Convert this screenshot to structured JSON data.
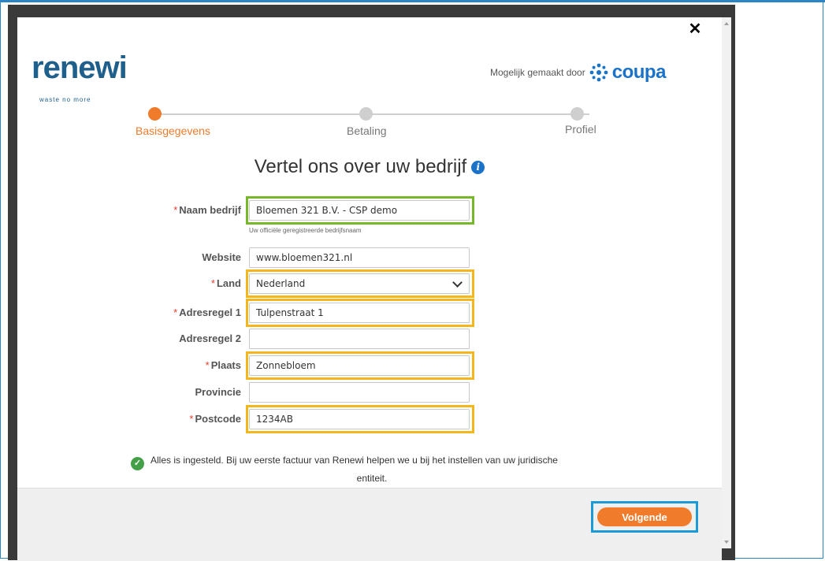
{
  "dialog": {
    "close_glyph": "✕"
  },
  "brand": {
    "logo_text": "renewi",
    "logo_tagline": "waste no more"
  },
  "powered_by": {
    "label": "Mogelijk gemaakt door",
    "brand": "coupa"
  },
  "steps": [
    {
      "label": "Basisgegevens",
      "state": "active"
    },
    {
      "label": "Betaling",
      "state": "inactive"
    },
    {
      "label": "Profiel",
      "state": "inactive"
    }
  ],
  "heading": {
    "title": "Vertel ons over uw bedrijf",
    "info_glyph": "i"
  },
  "form": {
    "company_name": {
      "label": "Naam bedrijf",
      "required": "*",
      "value": "Bloemen 321 B.V. - CSP demo",
      "hint": "Uw officiële geregistreerde bedrijfsnaam"
    },
    "website": {
      "label": "Website",
      "value": "www.bloemen321.nl"
    },
    "country": {
      "label": "Land",
      "required": "*",
      "value": "Nederland"
    },
    "address1": {
      "label": "Adresregel 1",
      "required": "*",
      "value": "Tulpenstraat 1"
    },
    "address2": {
      "label": "Adresregel 2",
      "value": ""
    },
    "city": {
      "label": "Plaats",
      "required": "*",
      "value": "Zonnebloem"
    },
    "province": {
      "label": "Provincie",
      "value": ""
    },
    "postcode": {
      "label": "Postcode",
      "required": "*",
      "value": "1234AB"
    }
  },
  "status": {
    "line1": "Alles is ingesteld. Bij uw eerste factuur van Renewi helpen we u bij het instellen van uw juridische",
    "line2": "entiteit.",
    "check_glyph": "✓"
  },
  "footer": {
    "next_label": "Volgende"
  },
  "colors": {
    "accent": "#f07b2a",
    "highlight_green": "#76b82a",
    "highlight_yellow": "#f3b61c",
    "highlight_blue": "#1a9ad6",
    "brand_blue": "#1e5f8c"
  }
}
